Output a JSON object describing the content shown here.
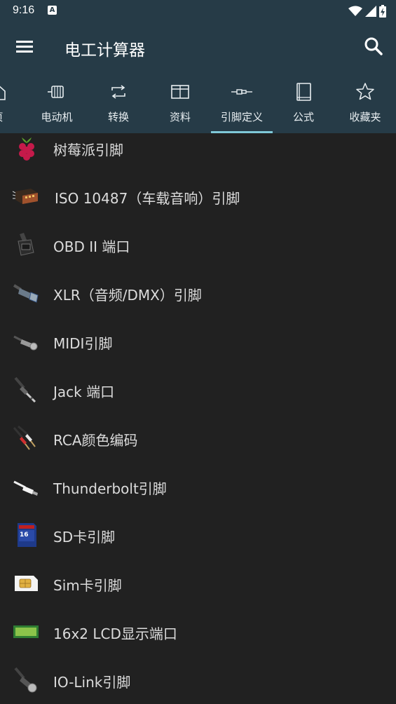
{
  "status": {
    "time": "9:16",
    "notification_glyph": "A"
  },
  "appbar": {
    "title": "电工计算器"
  },
  "tabs": [
    {
      "label": "页",
      "icon": "home-icon"
    },
    {
      "label": "电动机",
      "icon": "motor-icon"
    },
    {
      "label": "转换",
      "icon": "convert-icon"
    },
    {
      "label": "资料",
      "icon": "table-icon"
    },
    {
      "label": "引脚定义",
      "icon": "connector-icon",
      "active": true
    },
    {
      "label": "公式",
      "icon": "book-icon"
    },
    {
      "label": "收藏夹",
      "icon": "star-icon"
    }
  ],
  "items": [
    {
      "label": "树莓派引脚",
      "icon": "raspberry-pi-icon"
    },
    {
      "label": "ISO 10487（车载音响）引脚",
      "icon": "iso-connector-icon"
    },
    {
      "label": "OBD II 端口",
      "icon": "obd-port-icon"
    },
    {
      "label": "XLR（音频/DMX）引脚",
      "icon": "xlr-plug-icon"
    },
    {
      "label": "MIDI引脚",
      "icon": "midi-plug-icon"
    },
    {
      "label": "Jack 端口",
      "icon": "jack-plug-icon"
    },
    {
      "label": "RCA颜色编码",
      "icon": "rca-plug-icon"
    },
    {
      "label": "Thunderbolt引脚",
      "icon": "thunderbolt-plug-icon"
    },
    {
      "label": "SD卡引脚",
      "icon": "sd-card-icon"
    },
    {
      "label": "Sim卡引脚",
      "icon": "sim-card-icon"
    },
    {
      "label": "16x2 LCD显示端口",
      "icon": "lcd-display-icon"
    },
    {
      "label": "IO-Link引脚",
      "icon": "io-link-plug-icon"
    }
  ],
  "colors": {
    "appbar": "#263b47",
    "background": "#212121",
    "accent": "#7fc8d8",
    "text": "#dcdcdc"
  }
}
